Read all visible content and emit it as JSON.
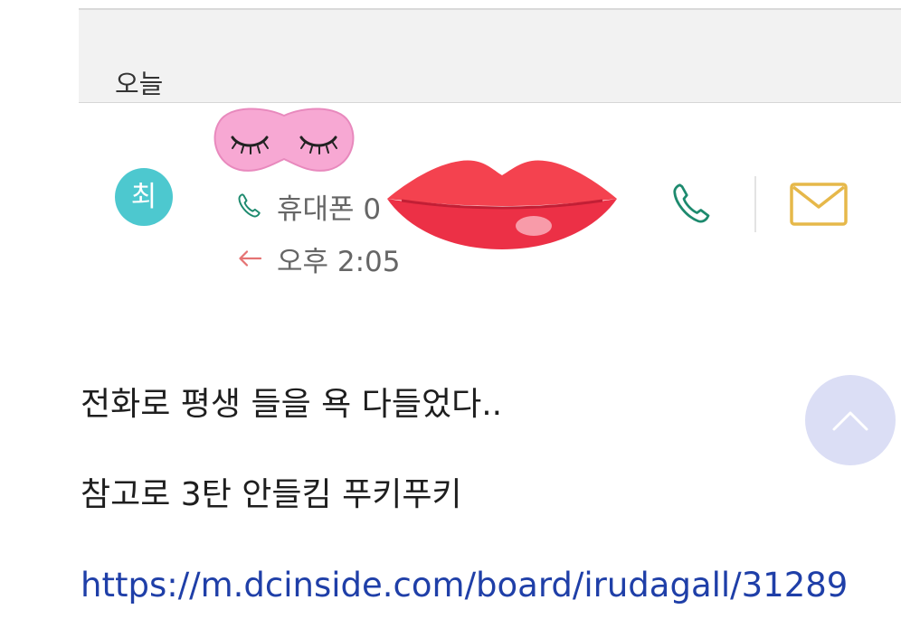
{
  "call_log": {
    "section_title": "오늘",
    "contact": {
      "avatar_initial": "최",
      "number_type": "휴대폰 0",
      "call_time": "오후 2:05",
      "call_direction_icon": "incoming-arrow-icon",
      "phone_type_icon": "phone-icon"
    },
    "actions": {
      "call_icon": "phone-icon",
      "message_icon": "envelope-icon"
    },
    "colors": {
      "avatar": "#4dc8cf",
      "call_icon": "#1d8a6e",
      "message_icon": "#e6b84a",
      "arrow": "#e57373"
    }
  },
  "post": {
    "line1": "전화로 평생 들을 욕 다들었다..",
    "line2": "참고로 3탄 안들킴 푸키푸키",
    "link": "https://m.dcinside.com/board/irudagall/31289",
    "link_color": "#1f3fa8"
  },
  "stickers": [
    "sleep-mask-sticker",
    "lips-sticker"
  ],
  "scroll_top_button": {
    "icon": "chevron-up-icon"
  }
}
